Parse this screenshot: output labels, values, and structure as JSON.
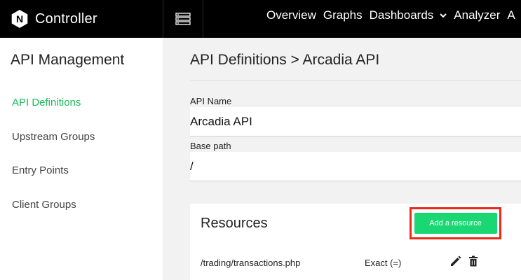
{
  "header": {
    "app_name": "Controller",
    "logo_letter": "N",
    "menu_icon": "server-stack-icon",
    "nav": [
      "Overview",
      "Graphs",
      "Dashboards",
      "Analyzer",
      "A"
    ]
  },
  "sidebar": {
    "title": "API Management",
    "items": [
      {
        "label": "API Definitions",
        "active": true
      },
      {
        "label": "Upstream Groups",
        "active": false
      },
      {
        "label": "Entry Points",
        "active": false
      },
      {
        "label": "Client Groups",
        "active": false
      }
    ]
  },
  "main": {
    "title": "API Definitions > Arcadia API",
    "api_name_label": "API Name",
    "api_name_value": "Arcadia API",
    "base_path_label": "Base path",
    "base_path_value": "/",
    "resources": {
      "title": "Resources",
      "add_button": "Add a resource",
      "rows": [
        {
          "path": "/trading/transactions.php",
          "match": "Exact (=)",
          "edit_icon": "pencil-icon",
          "delete_icon": "trash-icon"
        }
      ]
    }
  },
  "colors": {
    "accent_green": "#1dba5a",
    "button_green": "#19d874",
    "highlight_red": "#ea2a15",
    "topbar": "#000000"
  }
}
